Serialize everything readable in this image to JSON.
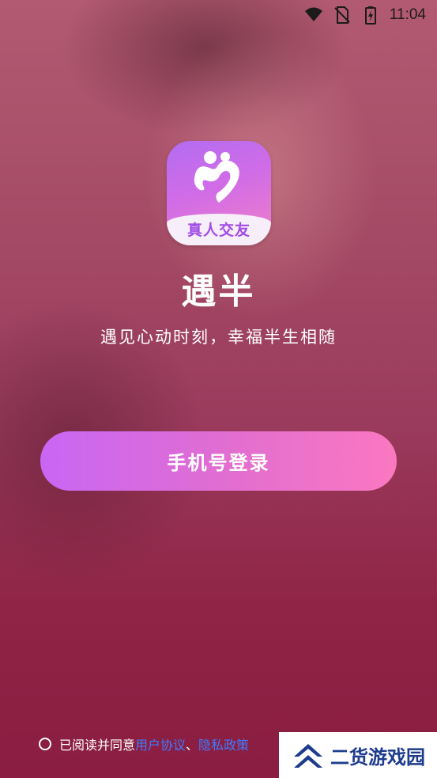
{
  "status_bar": {
    "time": "11:04",
    "icons": [
      "wifi-icon",
      "no-sim-icon",
      "battery-charging-icon"
    ]
  },
  "logo": {
    "badge_text": "真人交友",
    "colors": {
      "top": "#b36cf2",
      "bottom": "#f17fc8"
    }
  },
  "app_name": "遇半",
  "tagline": "遇见心动时刻，幸福半生相随",
  "login_button": {
    "label": "手机号登录"
  },
  "agreement": {
    "prefix": "已阅读并同意",
    "user_agreement": "用户协议",
    "separator": "、",
    "privacy_policy": "隐私政策"
  },
  "watermark": {
    "text": "二货游戏园"
  },
  "colors": {
    "link": "#3d7cff",
    "button_start": "#c866f4",
    "button_end": "#fb78c0"
  }
}
